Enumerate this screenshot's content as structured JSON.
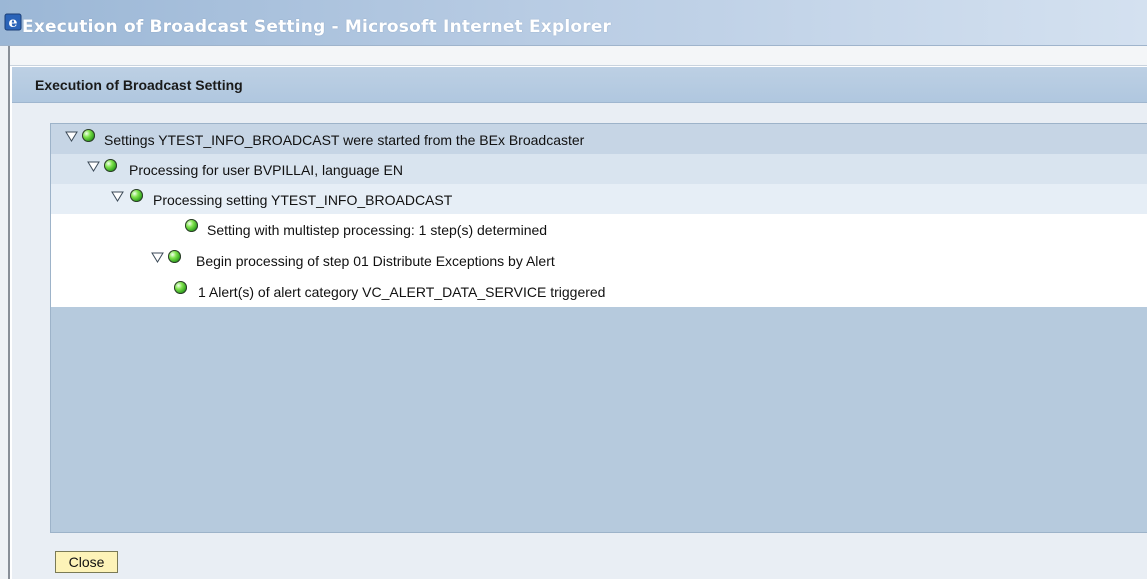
{
  "window": {
    "title": "Execution of Broadcast Setting - Microsoft Internet Explorer",
    "icon": "internet-explorer-icon"
  },
  "dialog": {
    "title": "Execution of Broadcast Setting",
    "close_label": "Close"
  },
  "tree": {
    "status_color": "#2dbb1e",
    "items": [
      {
        "label": "Settings YTEST_INFO_BROADCAST were started from the BEx Broadcaster",
        "expanded": true,
        "status": "success"
      },
      {
        "label": "Processing for user BVPILLAI, language EN",
        "expanded": true,
        "status": "success"
      },
      {
        "label": "Processing setting YTEST_INFO_BROADCAST",
        "expanded": true,
        "status": "success"
      },
      {
        "label": "Setting with multistep processing: 1 step(s) determined",
        "expanded": false,
        "status": "success"
      },
      {
        "label": "Begin processing of step 01 Distribute Exceptions by Alert",
        "expanded": true,
        "status": "success"
      },
      {
        "label": "1 Alert(s) of alert category VC_ALERT_DATA_SERVICE triggered",
        "expanded": false,
        "status": "success"
      }
    ]
  }
}
